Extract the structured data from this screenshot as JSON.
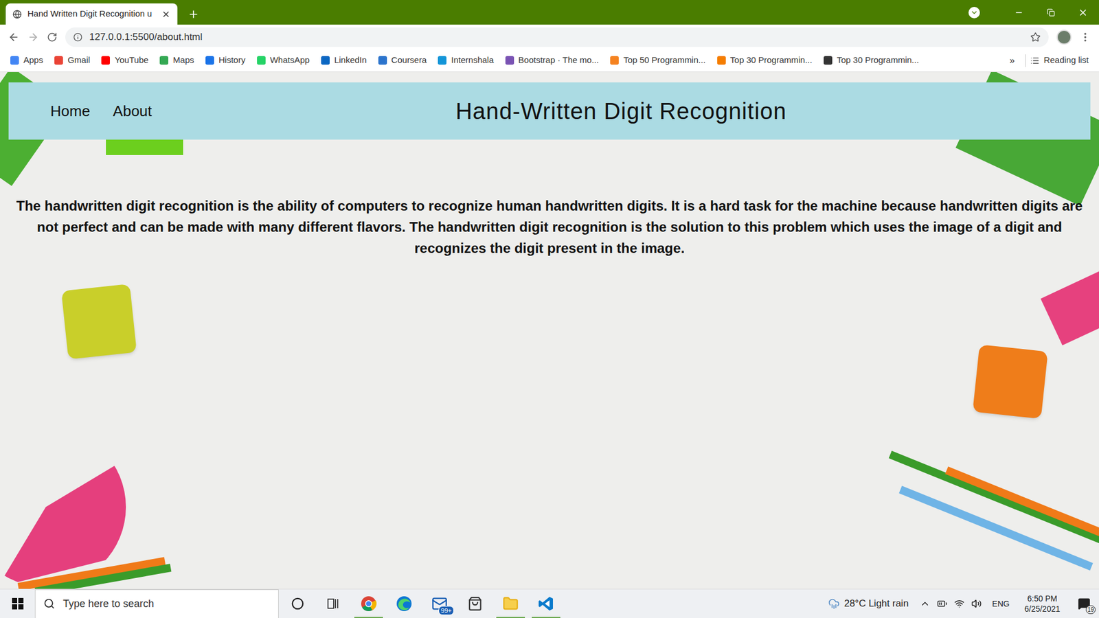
{
  "browser": {
    "tab": {
      "title": "Hand Written Digit Recognition u"
    },
    "url": "127.0.0.1:5500/about.html",
    "bookmarks": [
      {
        "label": "Apps",
        "color": "#4285f4"
      },
      {
        "label": "Gmail",
        "color": "#ea4335"
      },
      {
        "label": "YouTube",
        "color": "#ff0000"
      },
      {
        "label": "Maps",
        "color": "#34a853"
      },
      {
        "label": "History",
        "color": "#1a73e8"
      },
      {
        "label": "WhatsApp",
        "color": "#25d366"
      },
      {
        "label": "LinkedIn",
        "color": "#0a66c2"
      },
      {
        "label": "Coursera",
        "color": "#2a73cc"
      },
      {
        "label": "Internshala",
        "color": "#1295d8"
      },
      {
        "label": "Bootstrap · The mo...",
        "color": "#7952b3"
      },
      {
        "label": "Top 50 Programmin...",
        "color": "#f5821f"
      },
      {
        "label": "Top 30 Programmin...",
        "color": "#f57d00"
      },
      {
        "label": "Top 30 Programmin...",
        "color": "#333333"
      }
    ],
    "bookmarks_overflow": "»",
    "reading_list": "Reading list"
  },
  "page": {
    "nav": [
      {
        "label": "Home"
      },
      {
        "label": "About"
      }
    ],
    "title": "Hand-Written Digit Recognition",
    "paragraph": "The handwritten digit recognition is the ability of computers to recognize human handwritten digits. It is a hard task for the machine because handwritten digits are not perfect and can be made with many different flavors. The handwritten digit recognition is the solution to this problem which uses the image of a digit and recognizes the digit present in the image."
  },
  "taskbar": {
    "search_placeholder": "Type here to search",
    "apps": [
      {
        "kind": "cortana",
        "running": false
      },
      {
        "kind": "taskview",
        "running": false
      },
      {
        "kind": "chrome",
        "running": true
      },
      {
        "kind": "edge",
        "running": false
      },
      {
        "kind": "mail",
        "running": false,
        "badge": "99+"
      },
      {
        "kind": "store",
        "running": false
      },
      {
        "kind": "explorer",
        "running": true
      },
      {
        "kind": "vscode",
        "running": true
      }
    ],
    "weather": "28°C Light rain",
    "language": "ENG",
    "time": "6:50 PM",
    "date": "6/25/2021",
    "notifications": "19"
  }
}
